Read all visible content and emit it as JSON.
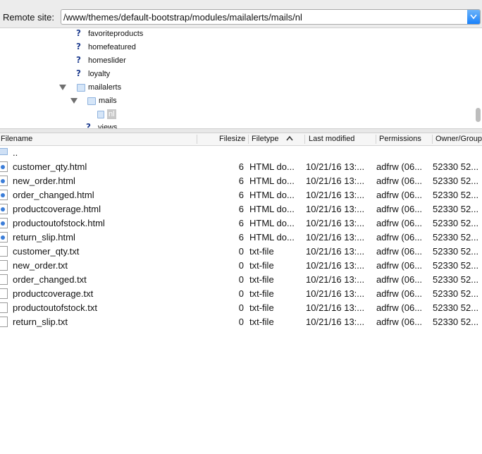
{
  "remote": {
    "label": "Remote site:",
    "path": "/www/themes/default-bootstrap/modules/mailalerts/mails/nl"
  },
  "tree": {
    "items": [
      {
        "label": "favoriteproducts",
        "icon": "question-icon"
      },
      {
        "label": "homefeatured",
        "icon": "question-icon"
      },
      {
        "label": "homeslider",
        "icon": "question-icon"
      },
      {
        "label": "loyalty",
        "icon": "question-icon"
      },
      {
        "label": "mailalerts",
        "icon": "folder-icon",
        "expanded": true
      },
      {
        "label": "mails",
        "icon": "folder-icon",
        "expanded": true
      },
      {
        "label": "nl",
        "icon": "folder-icon",
        "selected": true
      },
      {
        "label": "views",
        "icon": "question-icon"
      }
    ]
  },
  "columns": {
    "filename": "Filename",
    "filesize": "Filesize",
    "filetype": "Filetype",
    "modified": "Last modified",
    "permissions": "Permissions",
    "owner": "Owner/Group"
  },
  "files": [
    {
      "name": "..",
      "size": "",
      "type": "",
      "modified": "",
      "perms": "",
      "owner": "",
      "kind": "parent"
    },
    {
      "name": "customer_qty.html",
      "size": "6",
      "type": "HTML do...",
      "modified": "10/21/16 13:...",
      "perms": "adfrw (06...",
      "owner": "52330 52...",
      "kind": "html"
    },
    {
      "name": "new_order.html",
      "size": "6",
      "type": "HTML do...",
      "modified": "10/21/16 13:...",
      "perms": "adfrw (06...",
      "owner": "52330 52...",
      "kind": "html"
    },
    {
      "name": "order_changed.html",
      "size": "6",
      "type": "HTML do...",
      "modified": "10/21/16 13:...",
      "perms": "adfrw (06...",
      "owner": "52330 52...",
      "kind": "html"
    },
    {
      "name": "productcoverage.html",
      "size": "6",
      "type": "HTML do...",
      "modified": "10/21/16 13:...",
      "perms": "adfrw (06...",
      "owner": "52330 52...",
      "kind": "html"
    },
    {
      "name": "productoutofstock.html",
      "size": "6",
      "type": "HTML do...",
      "modified": "10/21/16 13:...",
      "perms": "adfrw (06...",
      "owner": "52330 52...",
      "kind": "html"
    },
    {
      "name": "return_slip.html",
      "size": "6",
      "type": "HTML do...",
      "modified": "10/21/16 13:...",
      "perms": "adfrw (06...",
      "owner": "52330 52...",
      "kind": "html"
    },
    {
      "name": "customer_qty.txt",
      "size": "0",
      "type": "txt-file",
      "modified": "10/21/16 13:...",
      "perms": "adfrw (06...",
      "owner": "52330 52...",
      "kind": "txt"
    },
    {
      "name": "new_order.txt",
      "size": "0",
      "type": "txt-file",
      "modified": "10/21/16 13:...",
      "perms": "adfrw (06...",
      "owner": "52330 52...",
      "kind": "txt"
    },
    {
      "name": "order_changed.txt",
      "size": "0",
      "type": "txt-file",
      "modified": "10/21/16 13:...",
      "perms": "adfrw (06...",
      "owner": "52330 52...",
      "kind": "txt"
    },
    {
      "name": "productcoverage.txt",
      "size": "0",
      "type": "txt-file",
      "modified": "10/21/16 13:...",
      "perms": "adfrw (06...",
      "owner": "52330 52...",
      "kind": "txt"
    },
    {
      "name": "productoutofstock.txt",
      "size": "0",
      "type": "txt-file",
      "modified": "10/21/16 13:...",
      "perms": "adfrw (06...",
      "owner": "52330 52...",
      "kind": "txt"
    },
    {
      "name": "return_slip.txt",
      "size": "0",
      "type": "txt-file",
      "modified": "10/21/16 13:...",
      "perms": "adfrw (06...",
      "owner": "52330 52...",
      "kind": "txt"
    }
  ],
  "colors": {
    "accent": "#1a82fb",
    "header_bg": "#f6f6f6",
    "toolbar_bg": "#ececec"
  }
}
